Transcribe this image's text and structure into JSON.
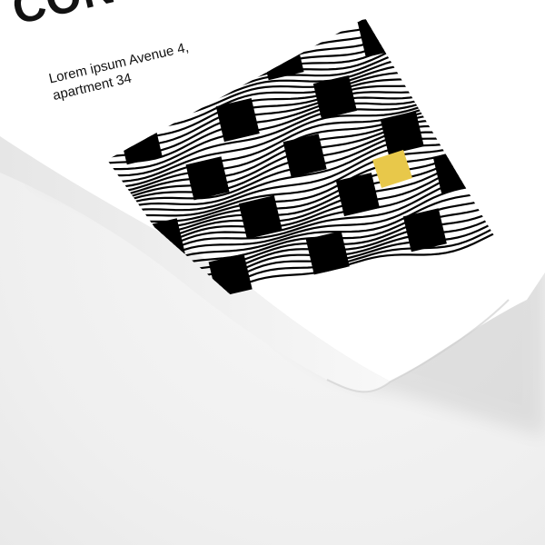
{
  "poster": {
    "title": "CON",
    "address_line1": "Lorem ipsum Avenue 4,",
    "address_line2": "apartment 34",
    "colors": {
      "paper": "#ffffff",
      "ink": "#000000",
      "accent": "#e8c84a",
      "background": "#efefef"
    }
  }
}
